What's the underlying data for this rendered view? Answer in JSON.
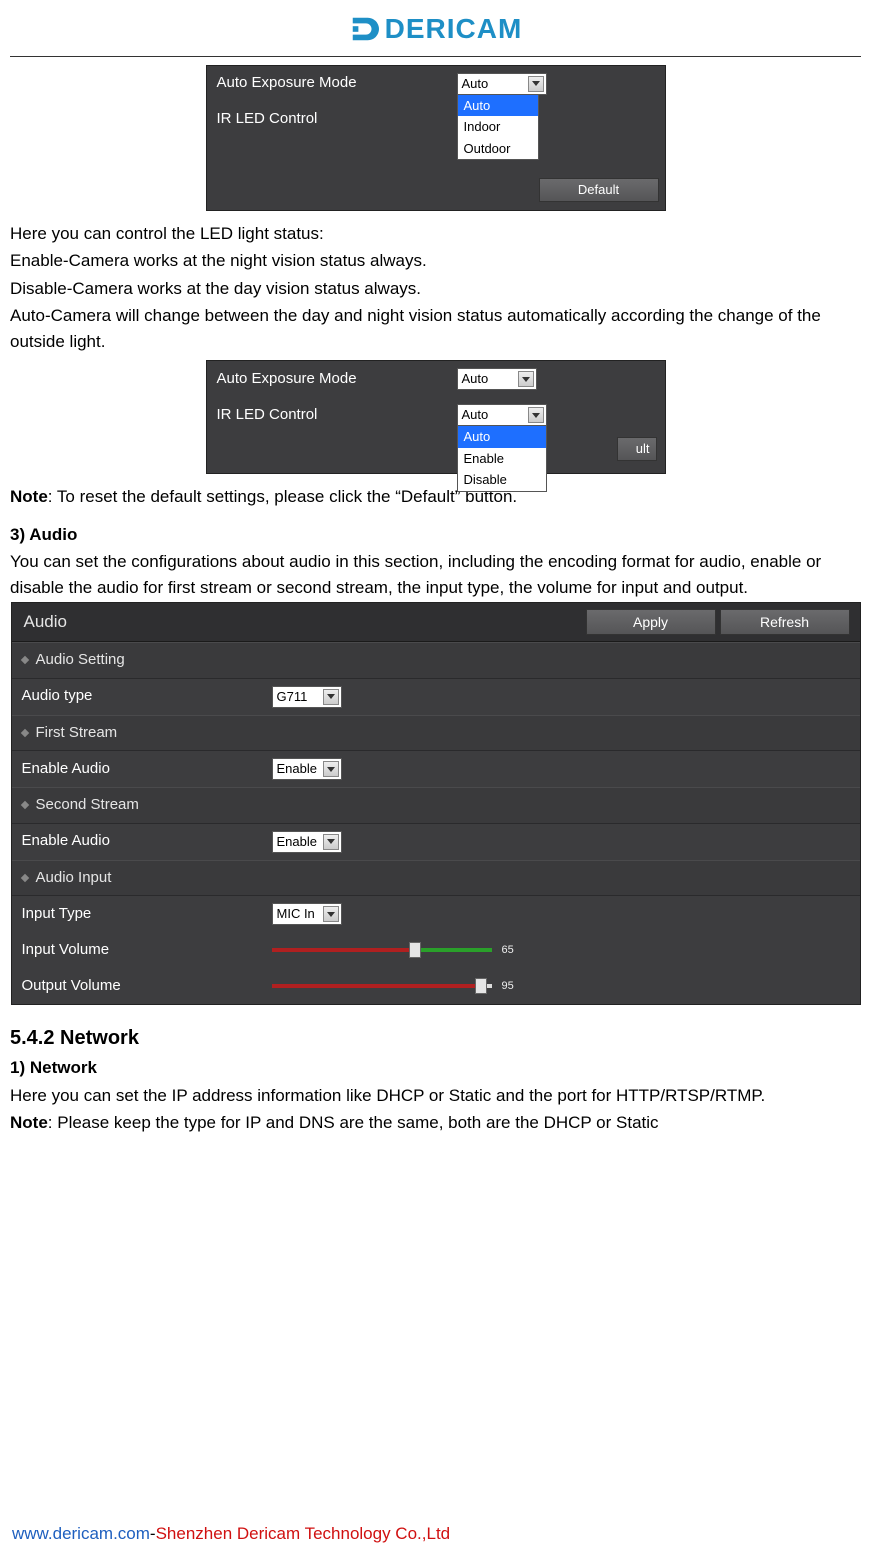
{
  "logo_text": "DERICAM",
  "panel1": {
    "rows": {
      "r0": {
        "label": "Auto Exposure Mode",
        "value": "Auto"
      },
      "r1": {
        "label": "IR LED Control"
      }
    },
    "dropdown": {
      "opt0": "Auto",
      "opt1": "Indoor",
      "opt2": "Outdoor"
    },
    "default_btn": "Default"
  },
  "body": {
    "line0": "Here you can control the LED light status:",
    "line1": "Enable-Camera works at the night vision status always.",
    "line2": "Disable-Camera works at the day vision status always.",
    "line3": "Auto-Camera will change between the day and night vision status automatically according the change of the outside light."
  },
  "panel2": {
    "rows": {
      "r0": {
        "label": "Auto Exposure Mode",
        "value": "Auto"
      },
      "r1": {
        "label": "IR LED Control",
        "value": "Auto"
      }
    },
    "dropdown": {
      "opt0": "Auto",
      "opt1": "Enable",
      "opt2": "Disable"
    },
    "default_btn_partial": "ult"
  },
  "note1_label": "Note",
  "note1_text": ": To reset the default settings, please click the “Default” button.",
  "audio_heading": "3) Audio",
  "audio_desc": "You can set the configurations about audio in this section, including the encoding format for audio, enable or disable the audio for first stream or second stream, the input type, the volume for input and output.",
  "audio_panel": {
    "title": "Audio",
    "apply_btn": "Apply",
    "refresh_btn": "Refresh",
    "groups": {
      "g0": "Audio Setting",
      "g1": "First Stream",
      "g2": "Second Stream",
      "g3": "Audio Input"
    },
    "rows": {
      "audio_type": {
        "label": "Audio type",
        "value": "G711"
      },
      "enable_audio1": {
        "label": "Enable Audio",
        "value": "Enable"
      },
      "enable_audio2": {
        "label": "Enable Audio",
        "value": "Enable"
      },
      "input_type": {
        "label": "Input Type",
        "value": "MIC In"
      },
      "input_volume": {
        "label": "Input Volume",
        "value": "65"
      },
      "output_volume": {
        "label": "Output Volume",
        "value": "95"
      }
    }
  },
  "network_heading": "5.4.2 Network",
  "network_sub": "1) Network",
  "network_line1": "Here you can set the IP address information like DHCP or Static and the port for HTTP/RTSP/RTMP.",
  "network_note_label": "Note",
  "network_note_text": ": Please keep the type for IP and DNS are the same, both are the DHCP or Static",
  "footer": {
    "url": "www.dericam.com",
    "sep": "-",
    "company": "Shenzhen Dericam Technology Co.,Ltd"
  }
}
